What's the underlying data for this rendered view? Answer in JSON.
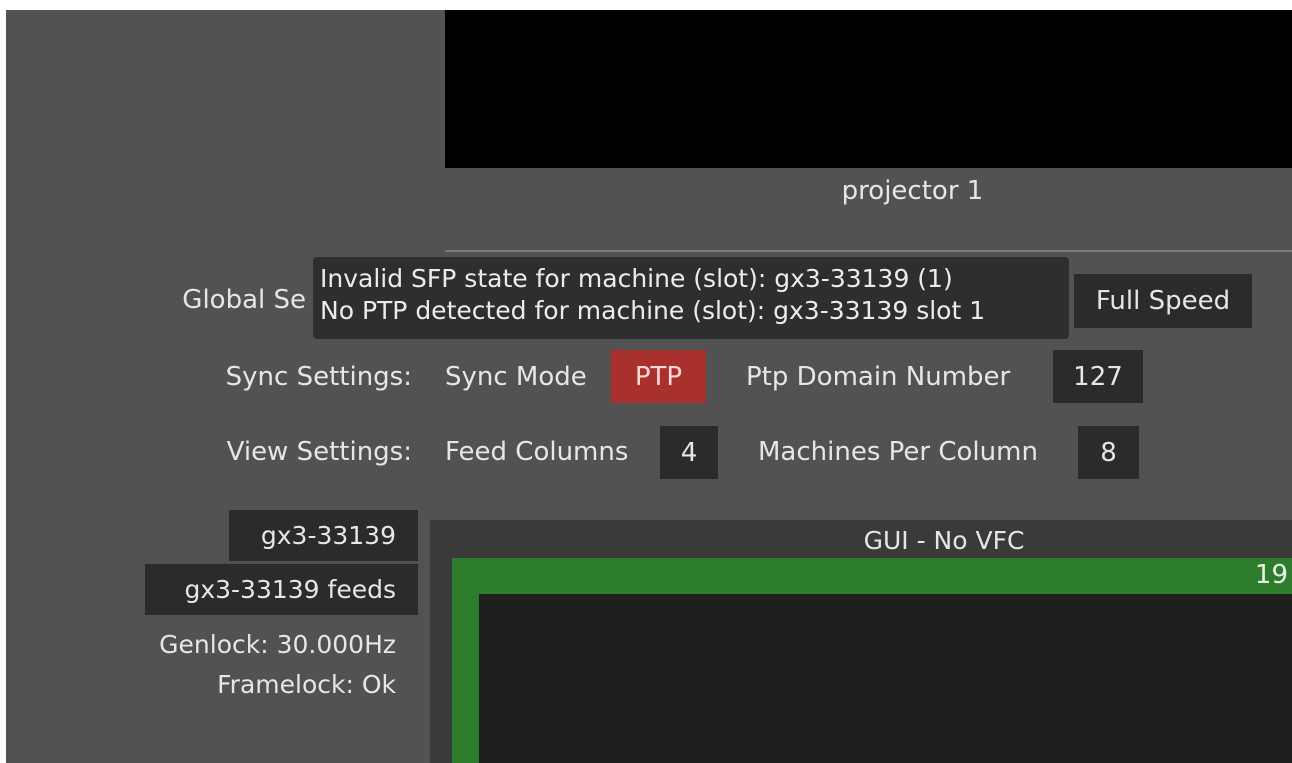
{
  "preview": {
    "projector_label": "projector 1"
  },
  "tooltip": {
    "line1": "Invalid SFP state for machine (slot): gx3-33139 (1)",
    "line2": "No PTP detected for machine (slot): gx3-33139 slot 1"
  },
  "global_settings": {
    "label": "Global Se",
    "value": "Full Speed"
  },
  "sync_settings": {
    "label": "Sync Settings:",
    "sync_mode_label": "Sync Mode",
    "sync_mode_value": "PTP",
    "ptp_domain_label": "Ptp Domain Number",
    "ptp_domain_value": "127"
  },
  "view_settings": {
    "label": "View Settings:",
    "feed_columns_label": "Feed Columns",
    "feed_columns_value": "4",
    "machines_per_column_label": "Machines Per Column",
    "machines_per_column_value": "8"
  },
  "machine": {
    "name": "gx3-33139",
    "feeds_label": "gx3-33139 feeds",
    "genlock": "Genlock: 30.000Hz",
    "framelock": "Framelock: Ok"
  },
  "gui_panel": {
    "title": "GUI - No VFC",
    "feed_number": "19"
  },
  "colors": {
    "background": "#525252",
    "active_sync_mode": "#a8302d",
    "feed_border": "#2d7d2d"
  }
}
